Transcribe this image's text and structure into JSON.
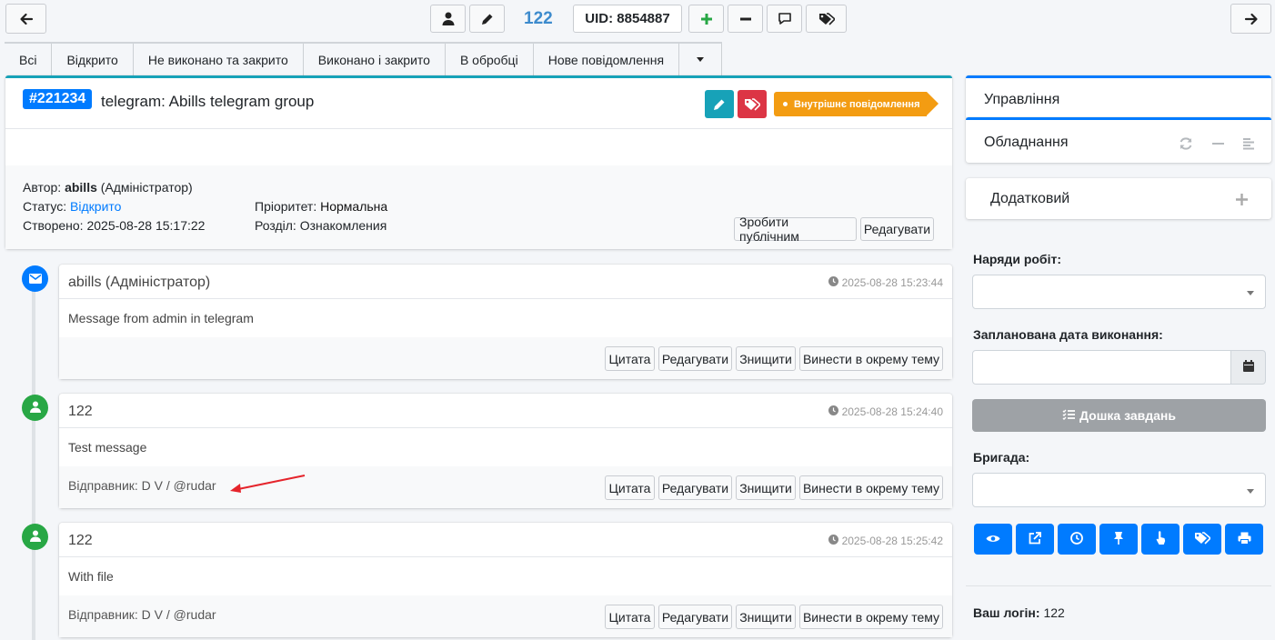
{
  "topbar": {
    "ticket_number": "122",
    "uid": "UID: 8854887"
  },
  "tabs": [
    {
      "label": "Всі"
    },
    {
      "label": "Відкрито"
    },
    {
      "label": "Не виконано та закрито"
    },
    {
      "label": "Виконано і закрито"
    },
    {
      "label": "В обробці"
    },
    {
      "label": "Нове повідомлення"
    }
  ],
  "ticket": {
    "id": "#221234",
    "title": "telegram: Abills telegram group",
    "badge": "Внутрішнє повідомлення",
    "author_label": "Автор:",
    "author_name": "abills",
    "author_role": "(Адміністратор)",
    "status_label": "Статус:",
    "status_value": "Відкрито",
    "created_label": "Створено:",
    "created_value": "2025-08-28 15:17:22",
    "priority_label": "Пріоритет:",
    "priority_value": "Нормальна",
    "section_label": "Розділ:",
    "section_value": "Ознакомления",
    "make_public": "Зробити публічним",
    "edit": "Редагувати"
  },
  "messages": [
    {
      "author": "abills (Адміністратор)",
      "time": "2025-08-28 15:23:44",
      "text": "Message from admin in telegram",
      "sender": ""
    },
    {
      "author": "122",
      "time": "2025-08-28 15:24:40",
      "text": "Test message",
      "sender": "Відправник: D V / @rudar"
    },
    {
      "author": "122",
      "time": "2025-08-28 15:25:42",
      "text": "With file",
      "sender": "Відправник: D V / @rudar"
    }
  ],
  "message_actions": {
    "quote": "Цитата",
    "edit": "Редагувати",
    "delete": "Знищити",
    "split": "Винести в окрему тему"
  },
  "right_panel": {
    "management": "Управління",
    "equipment": "Обладнання",
    "additional": "Додатковий",
    "work_orders_label": "Наряди робіт:",
    "planned_date_label": "Запланована дата виконання:",
    "task_board": "Дошка завдань",
    "brigade_label": "Бригада:",
    "login_label": "Ваш логін:",
    "login_value": "122"
  },
  "colors": {
    "primary": "#007bff",
    "info": "#17a2b8",
    "danger": "#dc3545",
    "warning": "#f39c12",
    "success": "#28a745",
    "secondary": "#9ea2a6"
  }
}
